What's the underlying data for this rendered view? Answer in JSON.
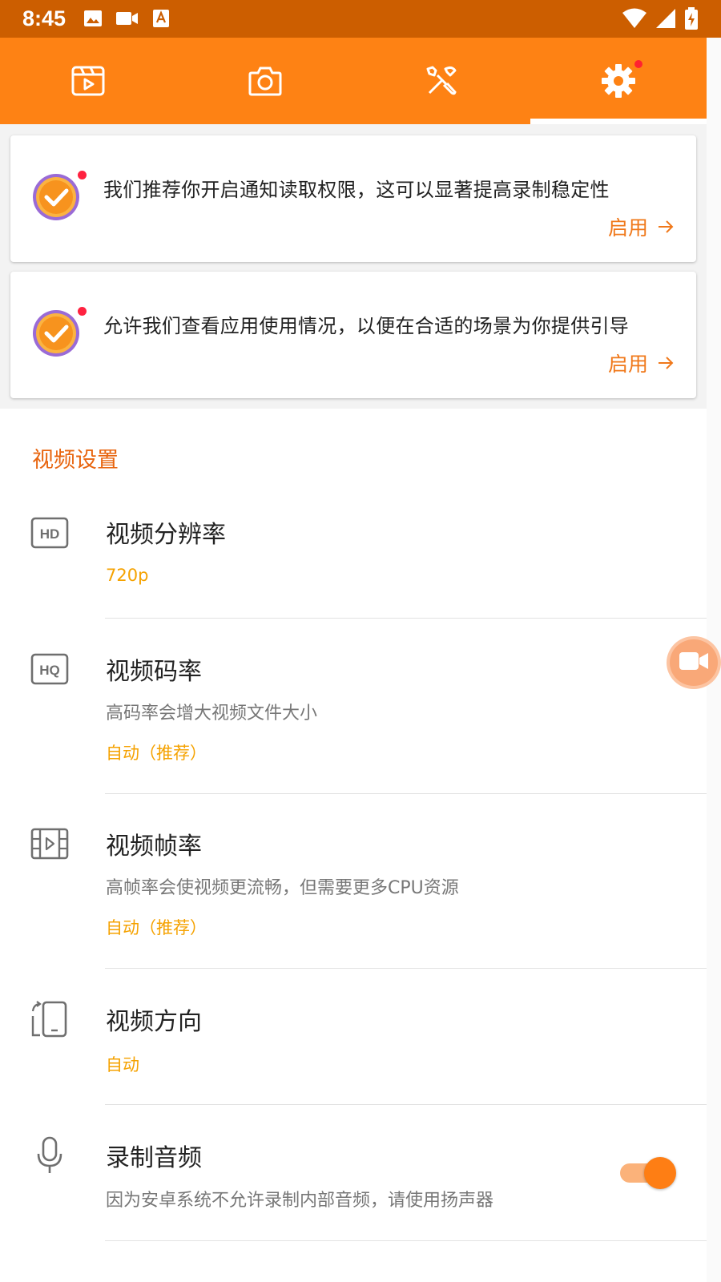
{
  "status_bar": {
    "time": "8:45"
  },
  "tabs": [
    {
      "icon": "video-list-icon"
    },
    {
      "icon": "camera-icon"
    },
    {
      "icon": "tools-icon"
    },
    {
      "icon": "settings-gear-icon",
      "active": true,
      "has_badge": true
    }
  ],
  "permission_cards": [
    {
      "text": "我们推荐你开启通知读取权限，这可以显著提高录制稳定性",
      "action": "启用"
    },
    {
      "text": "允许我们查看应用使用情况，以便在合适的场景为你提供引导",
      "action": "启用"
    }
  ],
  "section": {
    "title": "视频设置"
  },
  "settings": {
    "resolution": {
      "title": "视频分辨率",
      "value": "720p"
    },
    "bitrate": {
      "title": "视频码率",
      "desc": "高码率会增大视频文件大小",
      "value": "自动（推荐）"
    },
    "framerate": {
      "title": "视频帧率",
      "desc": "高帧率会使视频更流畅，但需要更多CPU资源",
      "value": "自动（推荐）"
    },
    "orientation": {
      "title": "视频方向",
      "value": "自动"
    },
    "audio": {
      "title": "录制音频",
      "desc": "因为安卓系统不允许录制内部音频，请使用扬声器",
      "enabled": true
    }
  },
  "colors": {
    "status_bar": "#cc5e00",
    "tab_bar": "#fe8214",
    "accent_text": "#e8650f",
    "value_text": "#f5a200",
    "badge": "#ff2230"
  }
}
